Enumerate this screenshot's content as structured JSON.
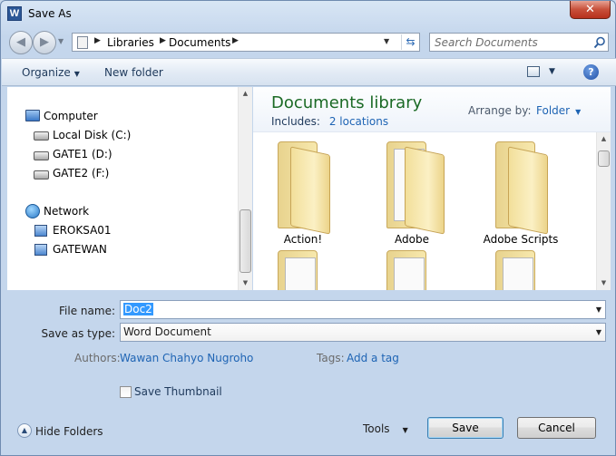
{
  "window": {
    "title": "Save As",
    "app_icon": "word-icon",
    "close_label": "✕"
  },
  "address": {
    "path": [
      "Libraries",
      "Documents"
    ],
    "search_placeholder": "Search Documents"
  },
  "toolbar": {
    "organize_label": "Organize",
    "new_folder_label": "New folder",
    "help_label": "?"
  },
  "navpane": {
    "computer_label": "Computer",
    "drives": [
      "Local Disk (C:)",
      "GATE1 (D:)",
      "GATE2 (F:)"
    ],
    "network_label": "Network",
    "network_items": [
      "EROKSA01",
      "GATEWAN"
    ]
  },
  "library": {
    "title": "Documents library",
    "includes_label": "Includes:",
    "includes_link": "2 locations",
    "arrange_label": "Arrange by:",
    "arrange_value": "Folder",
    "folders": [
      "Action!",
      "Adobe",
      "Adobe Scripts"
    ]
  },
  "form": {
    "filename_label": "File name:",
    "filename_value": "Doc2",
    "savetype_label": "Save as type:",
    "savetype_value": "Word Document",
    "authors_label": "Authors:",
    "authors_value": "Wawan Chahyo Nugroho",
    "tags_label": "Tags:",
    "tags_value": "Add a tag",
    "thumbnail_label": "Save Thumbnail",
    "thumbnail_checked": false
  },
  "footer": {
    "hide_folders_label": "Hide Folders",
    "tools_label": "Tools",
    "save_label": "Save",
    "cancel_label": "Cancel"
  },
  "colors": {
    "accent_link": "#1e64b4",
    "library_title": "#1b6a25",
    "selection": "#3399ff",
    "close_button": "#c8503a"
  }
}
